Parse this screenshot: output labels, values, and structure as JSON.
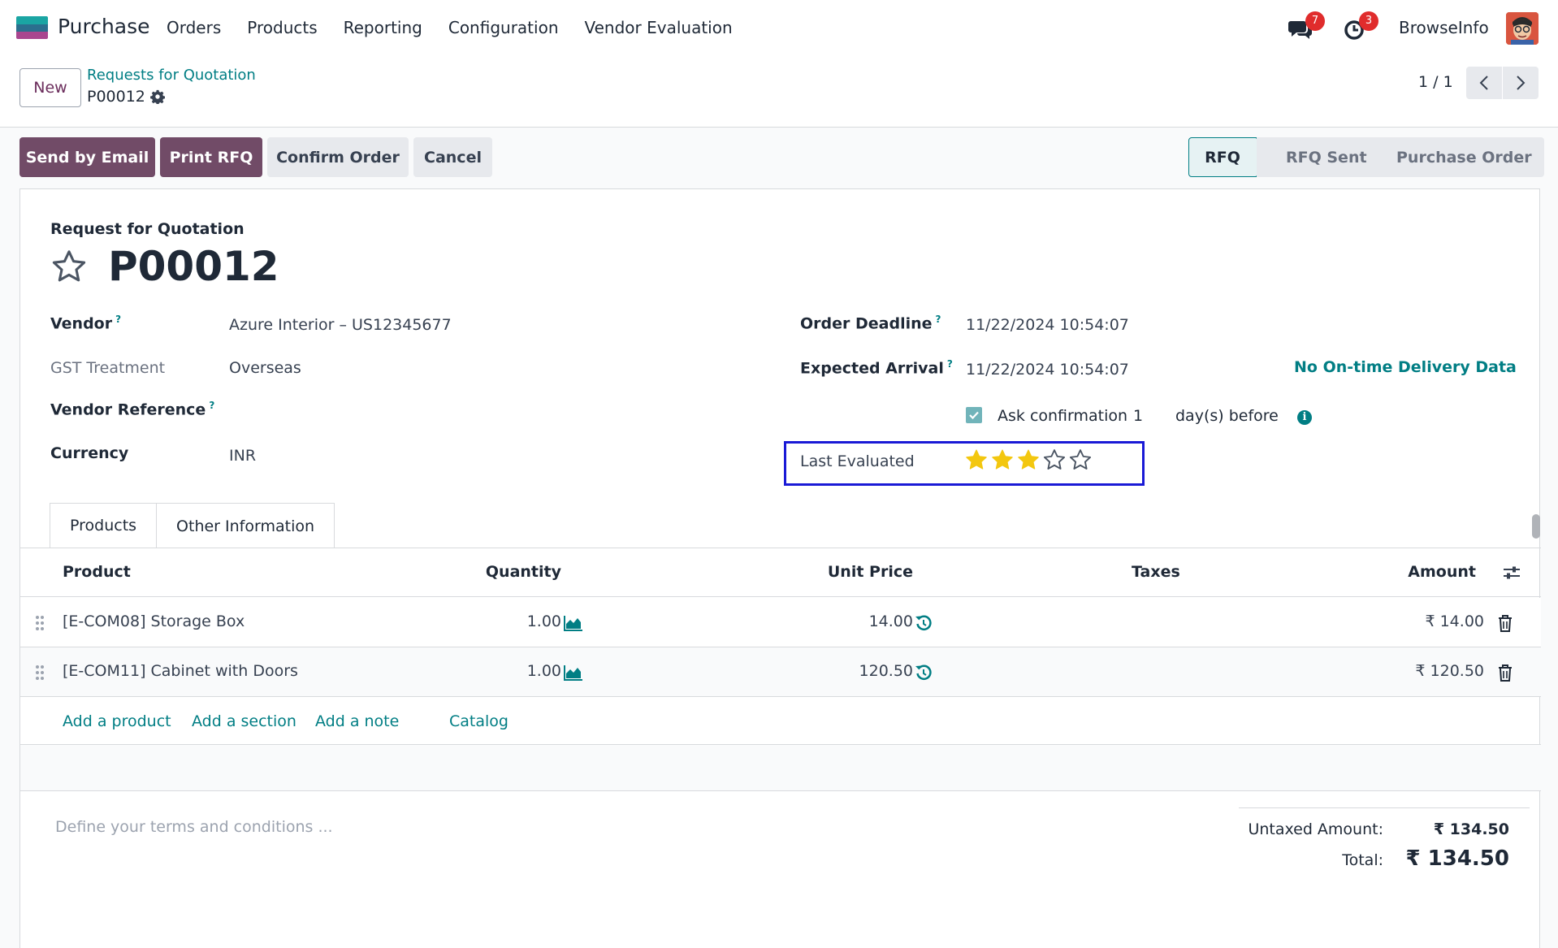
{
  "navbar": {
    "app_name": "Purchase",
    "menu": [
      "Orders",
      "Products",
      "Reporting",
      "Configuration",
      "Vendor Evaluation"
    ],
    "chat_badge": "7",
    "activity_badge": "3",
    "company": "BrowseInfo",
    "icons": [
      "chat-icon",
      "activity-clock-icon",
      "user-avatar"
    ]
  },
  "control_panel": {
    "new_label": "New",
    "breadcrumb_parent": "Requests for Quotation",
    "breadcrumb_current": "P00012",
    "pager": "1 / 1"
  },
  "actions": {
    "send_email": "Send by Email",
    "print_rfq": "Print RFQ",
    "confirm_order": "Confirm Order",
    "cancel": "Cancel"
  },
  "statusbar": {
    "stages": [
      "RFQ",
      "RFQ Sent",
      "Purchase Order"
    ],
    "current": "RFQ"
  },
  "form": {
    "title_label": "Request for Quotation",
    "name": "P00012",
    "vendor_label": "Vendor",
    "vendor_value": "Azure Interior – US12345677",
    "gst_label": "GST Treatment",
    "gst_value": "Overseas",
    "vendor_ref_label": "Vendor Reference",
    "currency_label": "Currency",
    "currency_value": "INR",
    "deadline_label": "Order Deadline",
    "deadline_value": "11/22/2024 10:54:07",
    "arrival_label": "Expected Arrival",
    "arrival_value": "11/22/2024 10:54:07",
    "no_delivery": "No On-time Delivery Data",
    "ask_confirmation_label": "Ask confirmation",
    "ask_confirmation_days": "1",
    "days_before": "day(s) before",
    "tooltip_mark": "?",
    "last_evaluated_label": "Last Evaluated",
    "rating": 3,
    "rating_max": 5,
    "colors": {
      "accent": "#017e84",
      "primary": "#714b67",
      "star": "#f3c70f",
      "highlight_box": "#1a1ad6"
    }
  },
  "tabs": [
    "Products",
    "Other Information"
  ],
  "table": {
    "headers": {
      "product": "Product",
      "quantity": "Quantity",
      "unit_price": "Unit Price",
      "taxes": "Taxes",
      "amount": "Amount"
    },
    "rows": [
      {
        "product": "[E-COM08] Storage Box",
        "quantity": "1.00",
        "unit_price": "14.00",
        "taxes": "",
        "amount": "₹ 14.00"
      },
      {
        "product": "[E-COM11] Cabinet with Doors",
        "quantity": "1.00",
        "unit_price": "120.50",
        "taxes": "",
        "amount": "₹ 120.50"
      }
    ],
    "add_links": [
      "Add a product",
      "Add a section",
      "Add a note",
      "Catalog"
    ]
  },
  "footer": {
    "terms_placeholder": "Define your terms and conditions ...",
    "untaxed_label": "Untaxed Amount:",
    "untaxed_value": "₹ 134.50",
    "total_label": "Total:",
    "total_value": "₹ 134.50"
  }
}
